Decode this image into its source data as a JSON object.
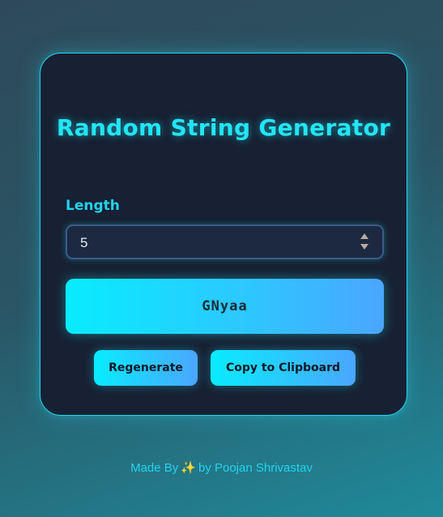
{
  "card": {
    "title": "Random String Generator",
    "length_label": "Length",
    "length_value": "5",
    "result": "GNyaa",
    "regenerate_label": "Regenerate",
    "copy_label": "Copy to Clipboard"
  },
  "footer": {
    "prefix": "Made By",
    "icon": "sparkles-icon",
    "suffix": "by Poojan Shrivastav"
  },
  "colors": {
    "accent": "#22d3ee",
    "card_bg": "#172133",
    "button_gradient_start": "#08ecff",
    "button_gradient_end": "#4aa6ff"
  }
}
